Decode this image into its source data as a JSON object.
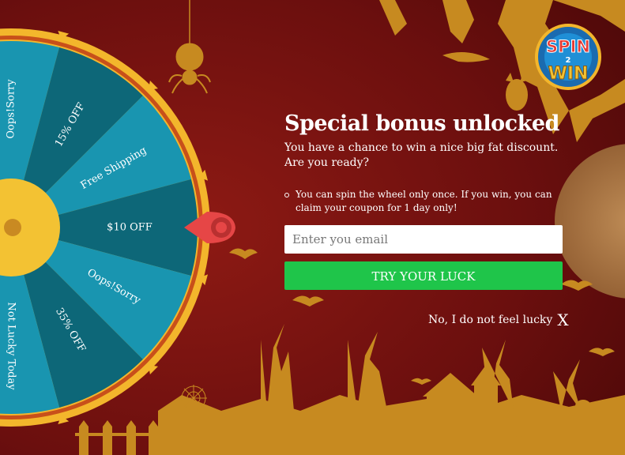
{
  "logo": {
    "top_text": "SPIN",
    "middle_text": "2",
    "bottom_text": "WIN"
  },
  "popup": {
    "title": "Special bonus unlocked",
    "subtitle": "You have a chance to win a nice big fat discount. Are you ready?",
    "rules": [
      "You can spin the wheel only once. If you win, you can claim your coupon for 1 day only!"
    ],
    "email_placeholder": "Enter you email",
    "email_value": "",
    "cta_label": "TRY YOUR LUCK",
    "decline_label": "No, I do not feel lucky",
    "decline_icon": "X"
  },
  "wheel": {
    "segments": [
      "Oops!Sorry",
      "15% OFF",
      "Free Shipping",
      "$10 OFF",
      "Oops!Sorry",
      "35% OFF",
      "Not Lucky Today"
    ]
  },
  "colors": {
    "background": "#6a0d0d",
    "wheel_light": "#1995b0",
    "wheel_dark": "#0d6778",
    "wheel_rim": "#f3b62c",
    "pointer": "#e64646",
    "button": "#1fc54a",
    "silhouette": "#c78a20"
  }
}
